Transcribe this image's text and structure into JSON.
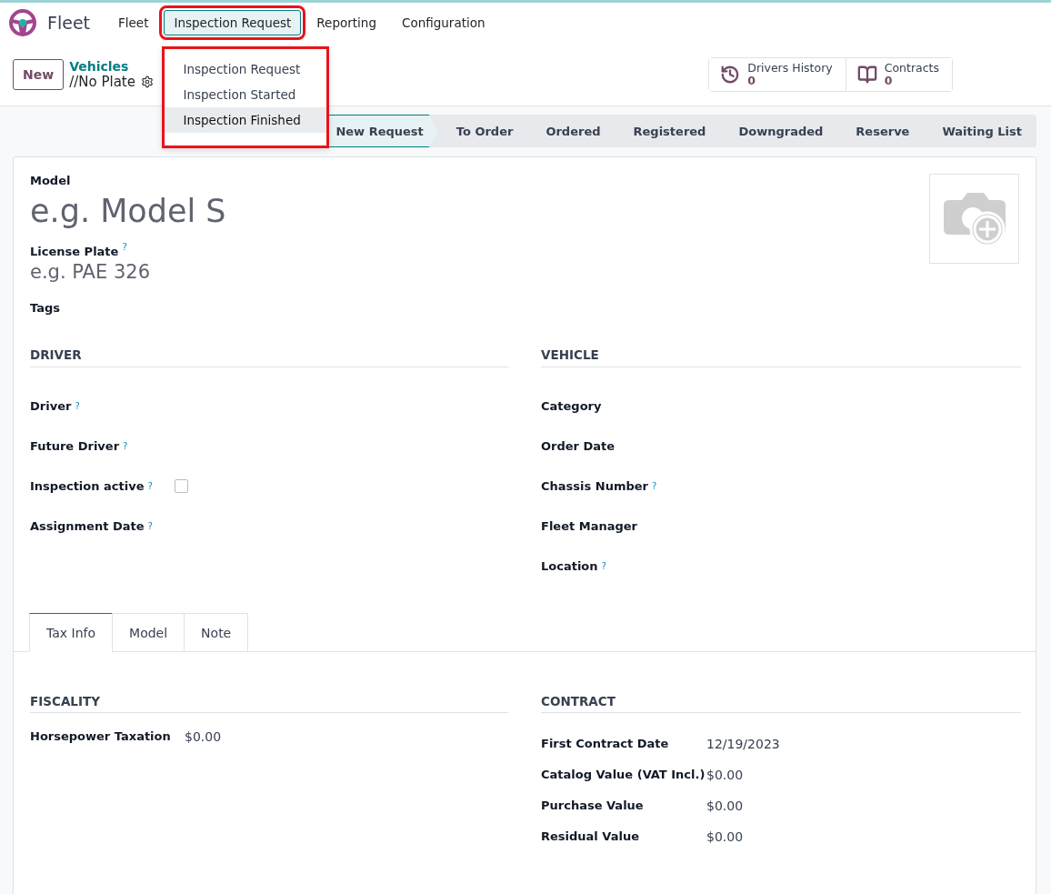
{
  "app": {
    "name": "Fleet"
  },
  "menu": [
    {
      "label": "Fleet",
      "selected": false,
      "highlighted": false
    },
    {
      "label": "Inspection Request",
      "selected": true,
      "highlighted": true
    },
    {
      "label": "Reporting",
      "selected": false,
      "highlighted": false
    },
    {
      "label": "Configuration",
      "selected": false,
      "highlighted": false
    }
  ],
  "dropdown": {
    "highlighted": true,
    "items": [
      {
        "label": "Inspection Request",
        "hovered": false
      },
      {
        "label": "Inspection Started",
        "hovered": false
      },
      {
        "label": "Inspection Finished",
        "hovered": true
      }
    ]
  },
  "breadcrumb": {
    "new_button": "New",
    "parent": "Vehicles",
    "current": "//No Plate"
  },
  "smart_buttons": [
    {
      "kind": "history",
      "label": "Drivers History",
      "count": "0"
    },
    {
      "kind": "book",
      "label": "Contracts",
      "count": "0"
    }
  ],
  "stages": [
    {
      "label": "New Request",
      "selected": true
    },
    {
      "label": "To Order",
      "selected": false
    },
    {
      "label": "Ordered",
      "selected": false
    },
    {
      "label": "Registered",
      "selected": false
    },
    {
      "label": "Downgraded",
      "selected": false
    },
    {
      "label": "Reserve",
      "selected": false
    },
    {
      "label": "Waiting List",
      "selected": false
    }
  ],
  "form": {
    "model_label": "Model",
    "model_placeholder": "e.g. Model S",
    "plate_label": "License Plate",
    "plate_help": "?",
    "plate_placeholder": "e.g. PAE 326",
    "tags_label": "Tags"
  },
  "groups": [
    {
      "title": "DRIVER",
      "fields": [
        {
          "kind": "text",
          "label": "Driver",
          "help": "?"
        },
        {
          "kind": "text",
          "label": "Future Driver",
          "help": "?"
        },
        {
          "kind": "checkbox",
          "label": "Inspection active",
          "help": "?",
          "checked": false
        },
        {
          "kind": "text",
          "label": "Assignment Date",
          "help": "?"
        }
      ]
    },
    {
      "title": "VEHICLE",
      "fields": [
        {
          "kind": "text",
          "label": "Category"
        },
        {
          "kind": "text",
          "label": "Order Date"
        },
        {
          "kind": "text",
          "label": "Chassis Number",
          "help": "?"
        },
        {
          "kind": "text",
          "label": "Fleet Manager"
        },
        {
          "kind": "text",
          "label": "Location",
          "help": "?"
        }
      ]
    }
  ],
  "tabs": [
    {
      "label": "Tax Info",
      "selected": true
    },
    {
      "label": "Model",
      "selected": false
    },
    {
      "label": "Note",
      "selected": false
    }
  ],
  "tab_groups": [
    {
      "title": "FISCALITY",
      "rows": [
        {
          "label": "Horsepower Taxation",
          "value": "$0.00"
        }
      ]
    },
    {
      "title": "CONTRACT",
      "rows": [
        {
          "label": "First Contract Date",
          "value": "12/19/2023"
        },
        {
          "label": "Catalog Value (VAT Incl.)",
          "value": "$0.00"
        },
        {
          "label": "Purchase Value",
          "value": "$0.00"
        },
        {
          "label": "Residual Value",
          "value": "$0.00"
        }
      ]
    }
  ]
}
